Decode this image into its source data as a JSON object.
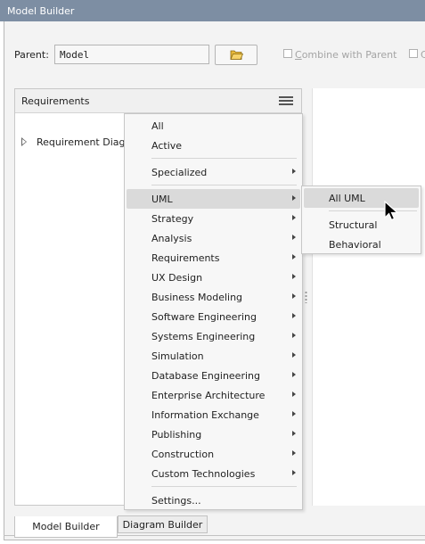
{
  "window": {
    "title": "Model Builder"
  },
  "toolbar": {
    "parent_label": "Parent:",
    "parent_value": "Model",
    "combine_label": "Combine with Parent",
    "checkbox2_label": "C"
  },
  "panel": {
    "title": "Requirements",
    "tree_item": "Requirement Diagram"
  },
  "menu": {
    "items": [
      {
        "label": "All"
      },
      {
        "label": "Active"
      },
      {
        "label": "Specialized"
      },
      {
        "label": "UML"
      },
      {
        "label": "Strategy"
      },
      {
        "label": "Analysis"
      },
      {
        "label": "Requirements"
      },
      {
        "label": "UX Design"
      },
      {
        "label": "Business Modeling"
      },
      {
        "label": "Software Engineering"
      },
      {
        "label": "Systems Engineering"
      },
      {
        "label": "Simulation"
      },
      {
        "label": "Database Engineering"
      },
      {
        "label": "Enterprise Architecture"
      },
      {
        "label": "Information Exchange"
      },
      {
        "label": "Publishing"
      },
      {
        "label": "Construction"
      },
      {
        "label": "Custom Technologies"
      },
      {
        "label": "Settings..."
      }
    ]
  },
  "submenu": {
    "items": [
      {
        "label": "All UML"
      },
      {
        "label": "Structural"
      },
      {
        "label": "Behavioral"
      }
    ]
  },
  "tabs": [
    {
      "label": "Model Builder"
    },
    {
      "label": "Diagram Builder"
    }
  ],
  "icons": {
    "folder": "folder-open-icon",
    "menu": "hamburger-menu-icon",
    "expand": "tree-expand-icon",
    "submenu": "chevron-right-icon"
  },
  "colors": {
    "titlebar": "#7d8ea3",
    "highlight": "#dadada",
    "folder": "#e8b93a"
  }
}
